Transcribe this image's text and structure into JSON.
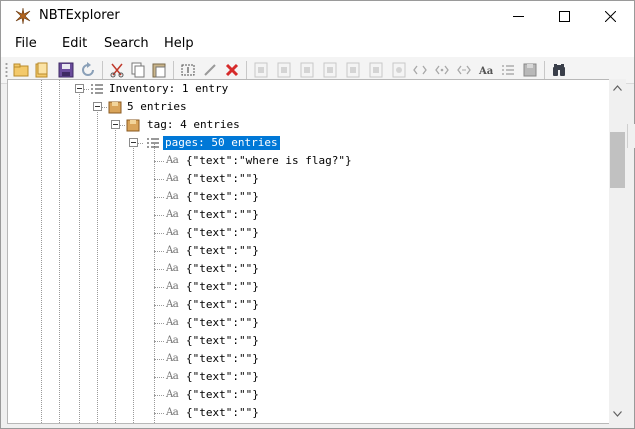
{
  "window": {
    "title": "NBTExplorer",
    "controls": {
      "minimize": "minimize",
      "maximize": "maximize",
      "close": "close"
    }
  },
  "menu": [
    {
      "label": "File"
    },
    {
      "label": "Edit"
    },
    {
      "label": "Search"
    },
    {
      "label": "Help"
    }
  ],
  "toolbar": {
    "buttons": [
      "open-folder-icon",
      "open-file-icon",
      "save-icon",
      "refresh-icon",
      "cut-icon",
      "copy-icon",
      "paste-icon",
      "rename-icon",
      "edit-icon",
      "delete-icon",
      "add-byte-icon",
      "add-short-icon",
      "add-int-icon",
      "add-long-icon",
      "add-float-icon",
      "add-double-icon",
      "add-byte-array-icon",
      "add-int-array-icon",
      "add-long-array-icon",
      "add-string-icon",
      "add-list-icon",
      "add-compound-icon",
      "find-icon"
    ],
    "accent_delete": "#d62b2b",
    "accent_save": "#5a3d8c"
  },
  "tree": {
    "nodes": [
      {
        "label": "Inventory: 1 entry",
        "type": "list"
      },
      {
        "label": "5 entries",
        "type": "compound"
      },
      {
        "label": "tag: 4 entries",
        "type": "compound"
      },
      {
        "label": "pages: 50 entries",
        "type": "list",
        "selected": true
      },
      {
        "label": "{\"text\":\"where is flag?\"}",
        "type": "string"
      },
      {
        "label": "{\"text\":\"\"}",
        "type": "string"
      },
      {
        "label": "{\"text\":\"\"}",
        "type": "string"
      },
      {
        "label": "{\"text\":\"\"}",
        "type": "string"
      },
      {
        "label": "{\"text\":\"\"}",
        "type": "string"
      },
      {
        "label": "{\"text\":\"\"}",
        "type": "string"
      },
      {
        "label": "{\"text\":\"\"}",
        "type": "string"
      },
      {
        "label": "{\"text\":\"\"}",
        "type": "string"
      },
      {
        "label": "{\"text\":\"\"}",
        "type": "string"
      },
      {
        "label": "{\"text\":\"\"}",
        "type": "string"
      },
      {
        "label": "{\"text\":\"\"}",
        "type": "string"
      },
      {
        "label": "{\"text\":\"\"}",
        "type": "string"
      },
      {
        "label": "{\"text\":\"\"}",
        "type": "string"
      },
      {
        "label": "{\"text\":\"\"}",
        "type": "string"
      },
      {
        "label": "{\"text\":\"\"}",
        "type": "string"
      }
    ],
    "string_icon_text": "Aa",
    "selection_color": "#0078d7"
  },
  "scrollbar": {
    "position_fraction": 0.14
  }
}
